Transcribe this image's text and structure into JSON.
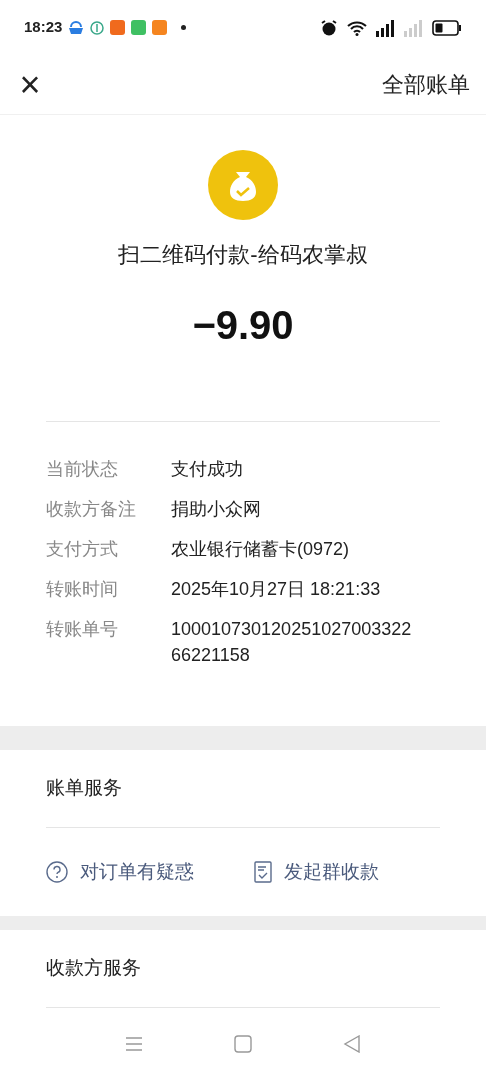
{
  "status_bar": {
    "time": "18:23"
  },
  "header": {
    "close": "×",
    "action": "全部账单"
  },
  "payment": {
    "title": "扫二维码付款-给码农掌叔",
    "amount": "−9.90"
  },
  "details": [
    {
      "label": "当前状态",
      "value": "支付成功"
    },
    {
      "label": "收款方备注",
      "value": "捐助小众网"
    },
    {
      "label": "支付方式",
      "value": "农业银行储蓄卡(0972)"
    },
    {
      "label": "转账时间",
      "value": "2025年10月27日 18:21:33"
    },
    {
      "label": "转账单号",
      "value": "100010730120251027003322\n66221158"
    }
  ],
  "bill_services": {
    "title": "账单服务",
    "actions": [
      {
        "kind": "question",
        "label": "对订单有疑惑"
      },
      {
        "kind": "bill",
        "label": "发起群收款"
      }
    ]
  },
  "payee_services": {
    "title": "收款方服务"
  }
}
